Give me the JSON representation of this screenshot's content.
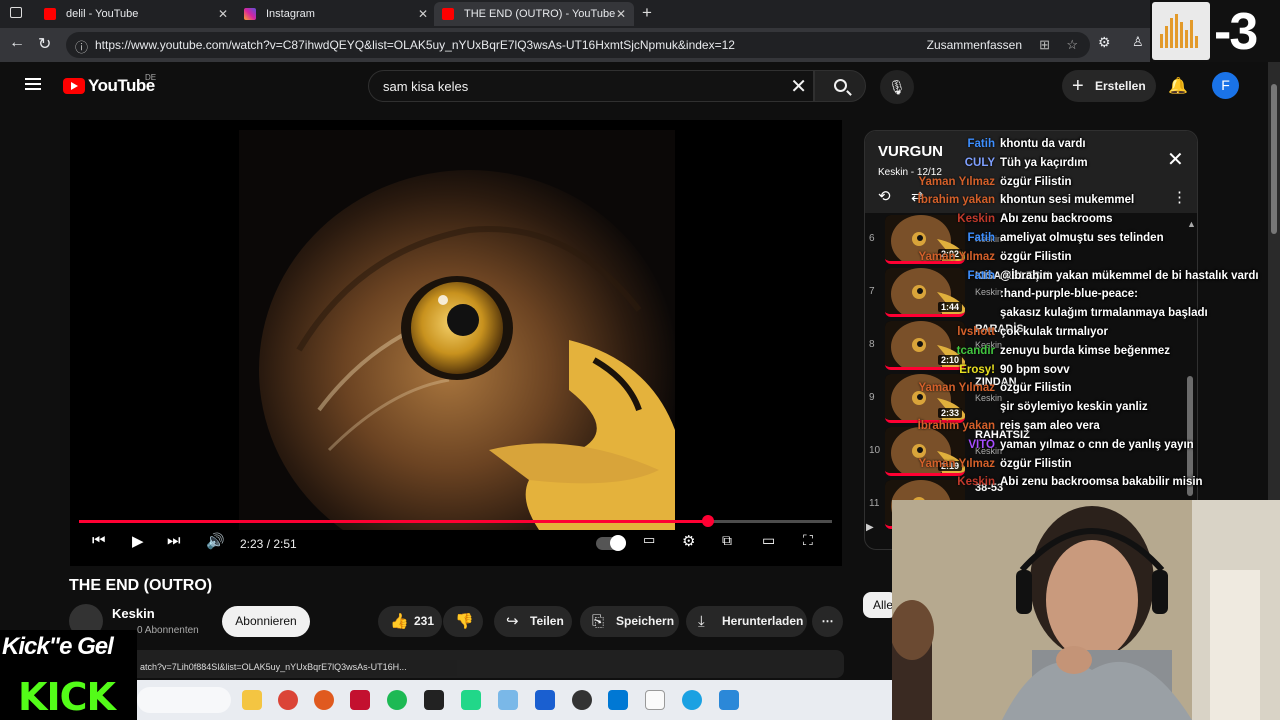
{
  "browser": {
    "tabs": [
      {
        "label": "delil - YouTube",
        "active": false,
        "icon": "youtube-favicon"
      },
      {
        "label": "Instagram",
        "active": false,
        "icon": "instagram-favicon"
      },
      {
        "label": "THE END (OUTRO) - YouTube",
        "active": true,
        "icon": "youtube-favicon"
      }
    ],
    "url": "https://www.youtube.com/watch?v=C87ihwdQEYQ&list=OLAK5uy_nYUxBqrE7lQ3wsAs-UT16HxmtSjcNpmuk&index=12",
    "summarize_label": "Zusammenfassen"
  },
  "overlay_top": {
    "number": "-3"
  },
  "youtube": {
    "logo_text": "YouTube",
    "country": "DE",
    "search_value": "sam kisa keles",
    "create_label": "Erstellen",
    "avatar_letter": "F"
  },
  "video": {
    "title": "THE END (OUTRO)",
    "time": "2:23 / 2:51",
    "progress": 0.835,
    "channel": "Keskin",
    "subscribers": "0 Abonnenten",
    "subscribe_label": "Abonnieren",
    "likes": "231",
    "share_label": "Teilen",
    "save_label": "Speichern",
    "download_label": "Herunterladen",
    "status_url": "atch?v=7Lih0f884Sl&list=OLAK5uy_nYUxBqrE7lQ3wsAs-UT16H..."
  },
  "playlist": {
    "title": "VURGUN",
    "subtitle": "Keskin - 12/12",
    "items": [
      {
        "index": "6",
        "name": "",
        "author": "Keskin",
        "duration": "2:02"
      },
      {
        "index": "7",
        "name": "KISA KELEŞ II",
        "author": "Keskin",
        "duration": "1:44"
      },
      {
        "index": "8",
        "name": "PARADİS",
        "author": "Keskin",
        "duration": "2:10"
      },
      {
        "index": "9",
        "name": "ZINDAN",
        "author": "Keskin",
        "duration": "2:33"
      },
      {
        "index": "10",
        "name": "RAHATSIZ",
        "author": "Keskin",
        "duration": "2:19"
      },
      {
        "index": "11",
        "name": "38-53",
        "author": "Keskin",
        "duration": "1:58"
      }
    ],
    "filter_label": "Alle"
  },
  "chat": [
    {
      "user": "Fatih",
      "color": "#3d8fff",
      "message": "khontu da vardı"
    },
    {
      "user": "CULY",
      "color": "#7fa0ff",
      "message": "Tüh ya kaçırdım"
    },
    {
      "user": "Yaman Yılmaz",
      "color": "#d4602a",
      "message": "özgür Filistin"
    },
    {
      "user": "İbrahim yakan",
      "color": "#d4602a",
      "message": "khontun sesi mukemmel"
    },
    {
      "user": "Keskin",
      "color": "#c0392b",
      "message": "Abı zenu backrooms"
    },
    {
      "user": "Fatih",
      "color": "#3d8fff",
      "message": "ameliyat olmuştu ses telinden"
    },
    {
      "user": "Yaman Yılmaz",
      "color": "#d4602a",
      "message": "özgür Filistin"
    },
    {
      "user": "Fatih",
      "color": "#3d8fff",
      "message": "@İbrahim yakan mükemmel de bi hastalık vardı"
    },
    {
      "user": "",
      "color": "#3d8fff",
      "message": ":hand-purple-blue-peace:"
    },
    {
      "user": "",
      "color": "#3d8fff",
      "message": "şakasız kulağım tırmalanmaya başladı"
    },
    {
      "user": "lvshott",
      "color": "#d4602a",
      "message": "çok kulak tırmalıyor"
    },
    {
      "user": "tcandir",
      "color": "#41c43f",
      "message": "zenuyu burda kimse beğenmez"
    },
    {
      "user": "Erosy!",
      "color": "#e8e021",
      "message": "90 bpm sovv"
    },
    {
      "user": "Yaman Yılmaz",
      "color": "#d4602a",
      "message": "özgür Filistin"
    },
    {
      "user": "",
      "color": "#ff4040",
      "message": "şir söylemiyo keskin yanliz"
    },
    {
      "user": "İbrahim yakan",
      "color": "#d4602a",
      "message": "reis şam aleo vera"
    },
    {
      "user": "VITO",
      "color": "#a64dff",
      "message": "yaman yılmaz o cnn de yanlış yayın"
    },
    {
      "user": "Yaman Yılmaz",
      "color": "#d4602a",
      "message": "özgür Filistin"
    },
    {
      "user": "Keskin",
      "color": "#c0392b",
      "message": "Abi zenu backroomsa bakabilir misin"
    }
  ],
  "kick": {
    "tagline": "Kick\"e Gel",
    "logo": "KICK"
  }
}
